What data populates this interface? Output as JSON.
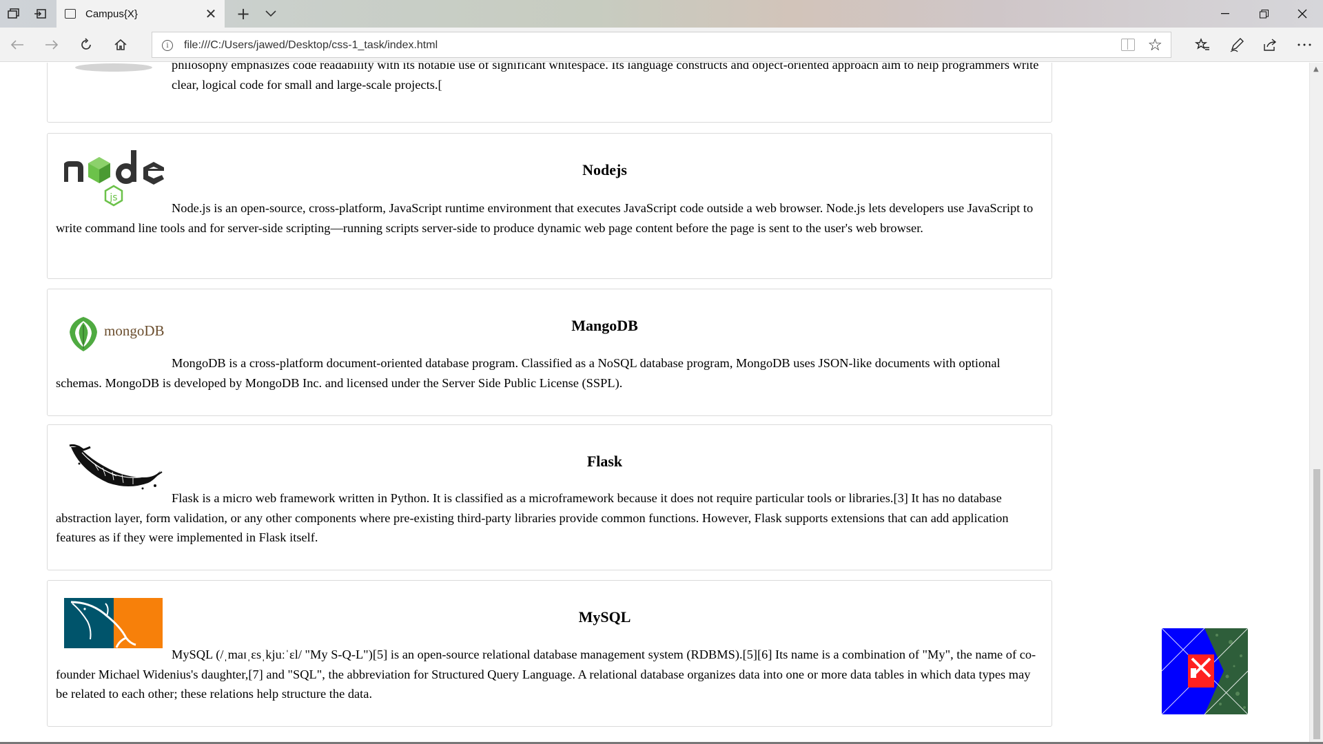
{
  "browser": {
    "tab": {
      "title": "Campus{X}"
    },
    "url": "file:///C:/Users/jawed/Desktop/css-1_task/index.html"
  },
  "icons": {
    "tabs_aside": "tabs-aside-icon",
    "restore_tabs": "restore-tabs-icon",
    "page": "page-icon",
    "close": "close-icon",
    "new_tab": "plus-icon",
    "tab_menu": "chevron-down-icon",
    "back": "back-arrow-icon",
    "forward": "forward-arrow-icon",
    "refresh": "refresh-icon",
    "home": "home-icon",
    "info": "info-icon",
    "reading_view": "reading-view-icon",
    "favorite": "star-icon",
    "favorites_hub": "favorites-list-icon",
    "notes": "pen-icon",
    "share": "share-icon",
    "more": "more-icon"
  },
  "cards": [
    {
      "partial_text": "philosophy emphasizes code readability with its notable use of significant whitespace. Its language constructs and object-oriented approach aim to help programmers write clear, logical code for small and large-scale projects.["
    },
    {
      "title": "Nodejs",
      "text": "Node.js is an open-source, cross-platform, JavaScript runtime environment that executes JavaScript code outside a web browser. Node.js lets developers use JavaScript to write command line tools and for server-side scripting—running scripts server-side to produce dynamic web page content before the page is sent to the user's web browser.",
      "logo_text": "js"
    },
    {
      "title": "MangoDB",
      "text": "MongoDB is a cross-platform document-oriented database program. Classified as a NoSQL database program, MongoDB uses JSON-like documents with optional schemas. MongoDB is developed by MongoDB Inc. and licensed under the Server Side Public License (SSPL).",
      "logo_text": "mongoDB"
    },
    {
      "title": "Flask",
      "text": "Flask is a micro web framework written in Python. It is classified as a microframework because it does not require particular tools or libraries.[3] It has no database abstraction layer, form validation, or any other components where pre-existing third-party libraries provide common functions. However, Flask supports extensions that can add application features as if they were implemented in Flask itself."
    },
    {
      "title": "MySQL",
      "text": "MySQL (/ˌmaɪˌɛsˌkjuːˈɛl/ \"My S-Q-L\")[5] is an open-source relational database management system (RDBMS).[5][6] Its name is a combination of \"My\", the name of co-founder Michael Widenius's daughter,[7] and \"SQL\", the abbreviation for Structured Query Language. A relational database organizes data into one or more data tables in which data types may be related to each other; these relations help structure the data."
    }
  ],
  "colors": {
    "node_green": "#6cc24a",
    "node_dark": "#333333",
    "mongo_green": "#4faa41",
    "mongo_text": "#6b4e2e",
    "mysql_blue": "#00546b",
    "mysql_orange": "#f7800a",
    "badge_blue": "#0000ff",
    "badge_red": "#ff2020"
  }
}
